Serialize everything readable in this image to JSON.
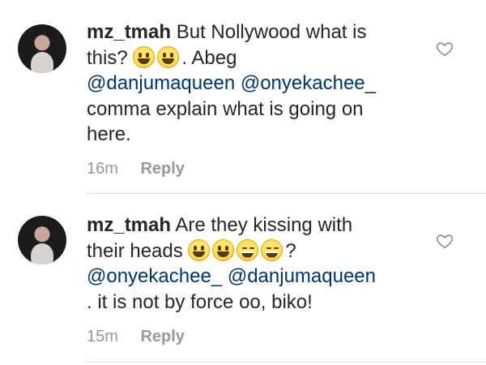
{
  "comments": [
    {
      "username": "mz_tmah",
      "text_line1": "But Nollywood what is",
      "text_line2a": "this?",
      "text_line2b": ". Abeg",
      "mention1": "@danjumaqueen",
      "mention2": "@onyekachee_",
      "text_line4": "comma explain what is going on",
      "text_line5": "here.",
      "time": "16m",
      "reply": "Reply",
      "emojis": [
        "grinning-face-icon",
        "grinning-face-icon"
      ]
    },
    {
      "username": "mz_tmah",
      "text_line1": "Are they kissing with",
      "text_line2a": "their heads",
      "text_line2b": "?",
      "mention1": "@onyekachee_",
      "mention2": "@danjumaqueen",
      "text_line4": ". it is not by force oo,  biko!",
      "time": "15m",
      "reply": "Reply",
      "emojis": [
        "grinning-face-icon",
        "grinning-face-icon",
        "tears-of-joy-icon",
        "tears-of-joy-icon"
      ]
    }
  ],
  "colors": {
    "mention": "#003569",
    "meta": "#999999",
    "divider": "#dbdbdb"
  }
}
